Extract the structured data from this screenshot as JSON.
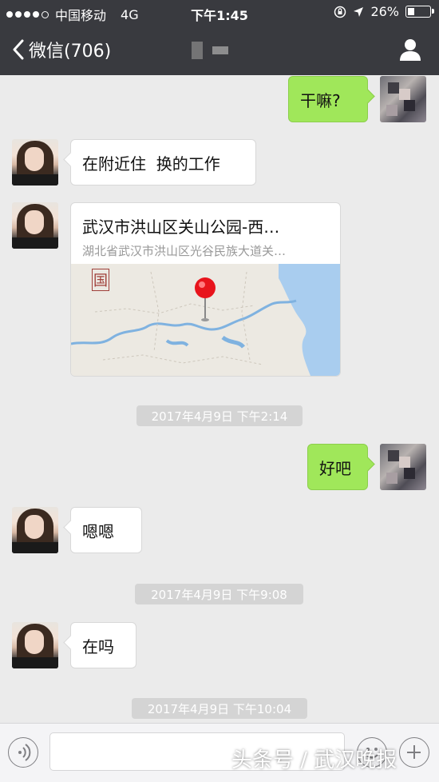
{
  "status_bar": {
    "carrier": "中国移动",
    "network": "4G",
    "time": "下午1:45",
    "battery": "26%"
  },
  "nav": {
    "back_label": "微信(706)"
  },
  "messages": {
    "m1": "干嘛?",
    "m2": "在附近住  换的工作",
    "location": {
      "title": "武汉市洪山区关山公园-西…",
      "address": "湖北省武汉市洪山区光谷民族大道关…",
      "map_label": "国"
    },
    "ts1": "2017年4月9日 下午2:14",
    "m3": "好吧",
    "m4": "嗯嗯",
    "ts2": "2017年4月9日 下午9:08",
    "m5": "在吗",
    "ts3": "2017年4月9日 下午10:04"
  },
  "watermark": "头条号 / 武汉晚报",
  "icons": [
    "chevron-left-icon",
    "person-icon",
    "voice-icon",
    "emoji-icon",
    "plus-icon",
    "lock-rotation-icon",
    "location-arrow-icon",
    "battery-icon"
  ]
}
